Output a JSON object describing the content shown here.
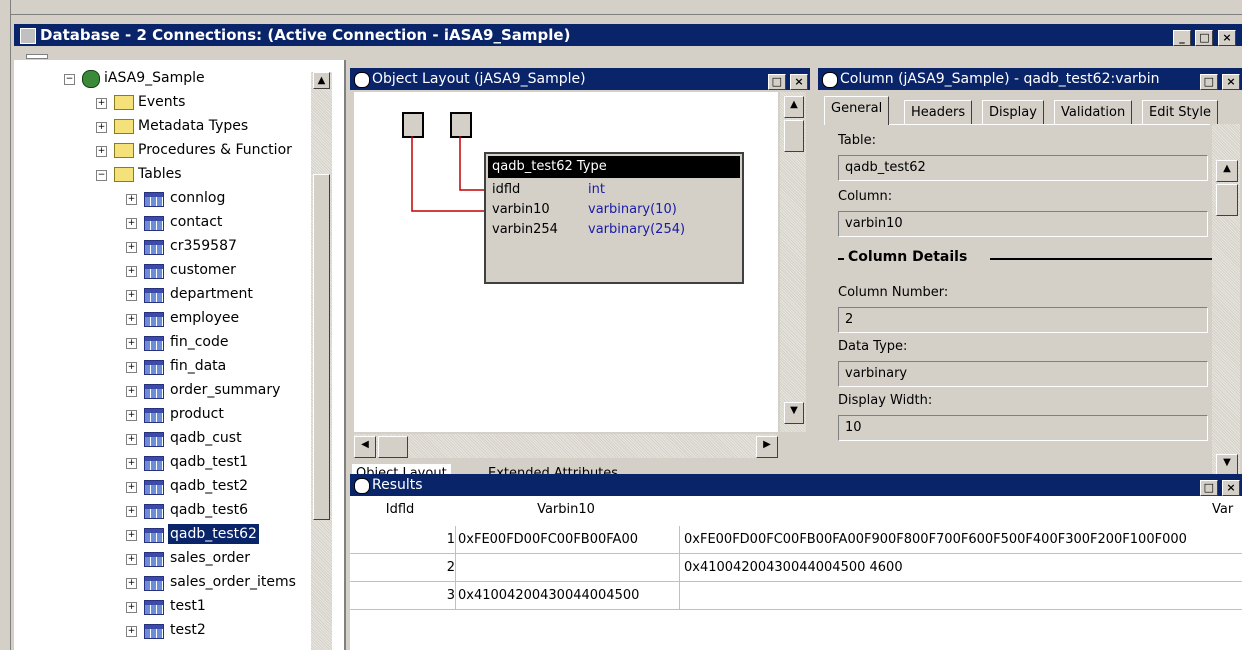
{
  "window": {
    "title": "Database - 2 Connections: (Active Connection - iASA9_Sample)",
    "buttons": [
      "_",
      "□",
      "×"
    ]
  },
  "tree": {
    "root_label": "iASA9_Sample",
    "folders": [
      "Events",
      "Metadata Types",
      "Procedures & Functior",
      "Tables"
    ],
    "tables": [
      "connlog",
      "contact",
      "cr359587",
      "customer",
      "department",
      "employee",
      "fin_code",
      "fin_data",
      "order_summary",
      "product",
      "qadb_cust",
      "qadb_test1",
      "qadb_test2",
      "qadb_test6",
      "qadb_test62",
      "sales_order",
      "sales_order_items",
      "test1",
      "test2"
    ],
    "selected": "qadb_test62"
  },
  "object_layout": {
    "title": "Object Layout (jASA9_Sample)",
    "table_box": {
      "header_name": "qadb_test62",
      "header_type": "Type",
      "columns": [
        {
          "name": "idfld",
          "type": "int"
        },
        {
          "name": "varbin10",
          "type": "varbinary(10)"
        },
        {
          "name": "varbin254",
          "type": "varbinary(254)"
        }
      ]
    },
    "tabs": [
      "Object Layout",
      "Extended Attributes"
    ]
  },
  "column_panel": {
    "title": "Column (jASA9_Sample) - qadb_test62:varbin",
    "tabs": [
      "General",
      "Headers",
      "Display",
      "Validation",
      "Edit Style"
    ],
    "table_label": "Table:",
    "table_value": "qadb_test62",
    "column_label": "Column:",
    "column_value": "varbin10",
    "details_heading": "Column Details",
    "column_number_label": "Column Number:",
    "column_number_value": "2",
    "data_type_label": "Data Type:",
    "data_type_value": "varbinary",
    "display_width_label": "Display Width:",
    "display_width_value": "10"
  },
  "results": {
    "title": "Results",
    "headers": [
      "Idfld",
      "Varbin10",
      "Var"
    ],
    "rows": [
      {
        "idfld": "1",
        "varbin10": "0xFE00FD00FC00FB00FA00",
        "varbin254": "0xFE00FD00FC00FB00FA00F900F800F700F600F500F400F300F200F100F000"
      },
      {
        "idfld": "2",
        "varbin10": "",
        "varbin254": "0x41004200430044004500 4600"
      },
      {
        "idfld": "3",
        "varbin10": "0x41004200430044004500",
        "varbin254": ""
      }
    ]
  }
}
